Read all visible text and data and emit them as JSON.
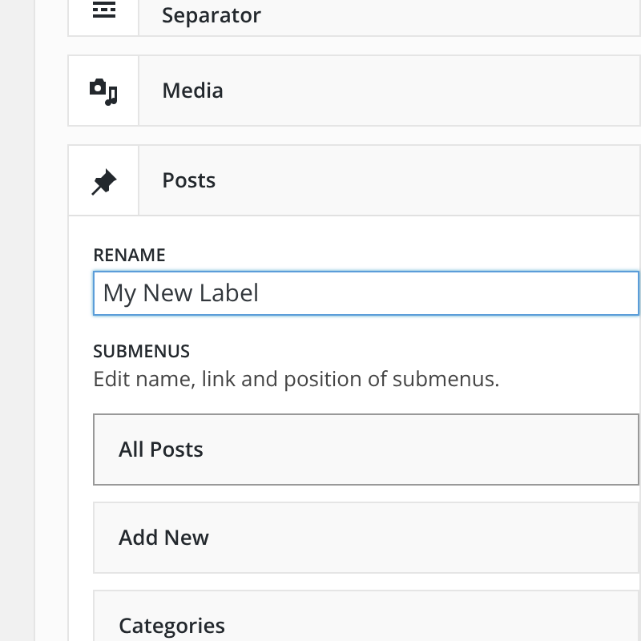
{
  "menu_items": [
    {
      "label": "Separator",
      "kind": "separator",
      "expanded": false
    },
    {
      "label": "Media",
      "kind": "media",
      "expanded": false
    },
    {
      "label": "Posts",
      "kind": "posts",
      "expanded": true,
      "rename": {
        "label": "RENAME",
        "value": "My New Label"
      },
      "submenus": {
        "label": "SUBMENUS",
        "description": "Edit name, link and position of submenus.",
        "items": [
          {
            "label": "All Posts",
            "selected": true
          },
          {
            "label": "Add New",
            "selected": false
          },
          {
            "label": "Categories",
            "selected": false
          }
        ]
      }
    }
  ]
}
